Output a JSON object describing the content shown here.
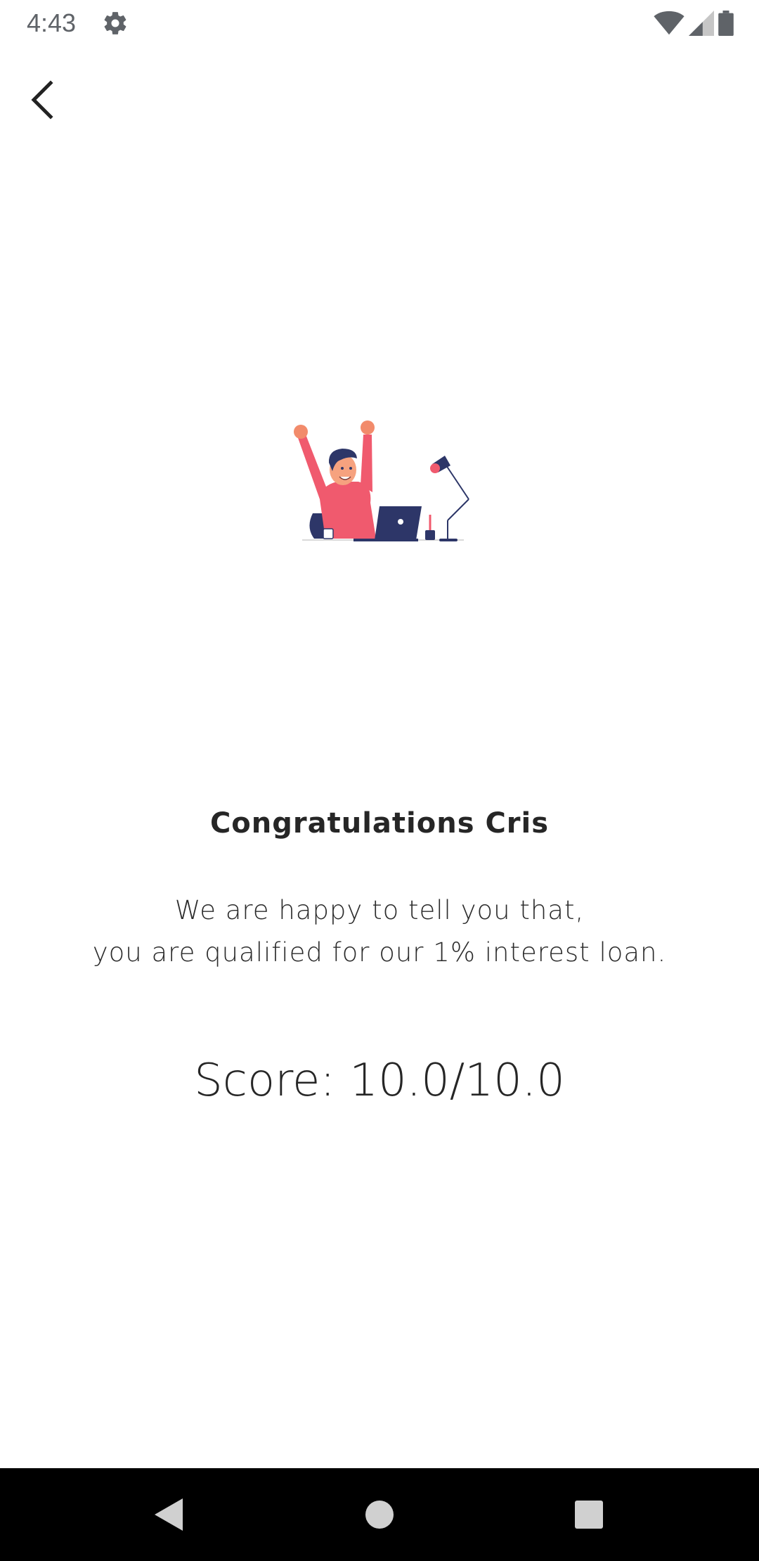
{
  "status_bar": {
    "time": "4:43",
    "icons": [
      "settings-gear-icon",
      "wifi-icon",
      "cellular-signal-icon",
      "battery-icon"
    ]
  },
  "header": {
    "back_icon": "chevron-left-icon"
  },
  "illustration": {
    "icon": "celebrating-person-at-desk-illustration"
  },
  "content": {
    "title": "Congratulations  Cris",
    "message_line1": "We are happy to tell you that,",
    "message_line2": "you are qualified for our 1% interest loan.",
    "score": "Score: 10.0/10.0"
  },
  "nav_bar": {
    "buttons": [
      "back-triangle-icon",
      "home-circle-icon",
      "recents-square-icon"
    ]
  },
  "colors": {
    "accent": "#F05A6E",
    "navy": "#2D3668",
    "text": "#262626"
  }
}
